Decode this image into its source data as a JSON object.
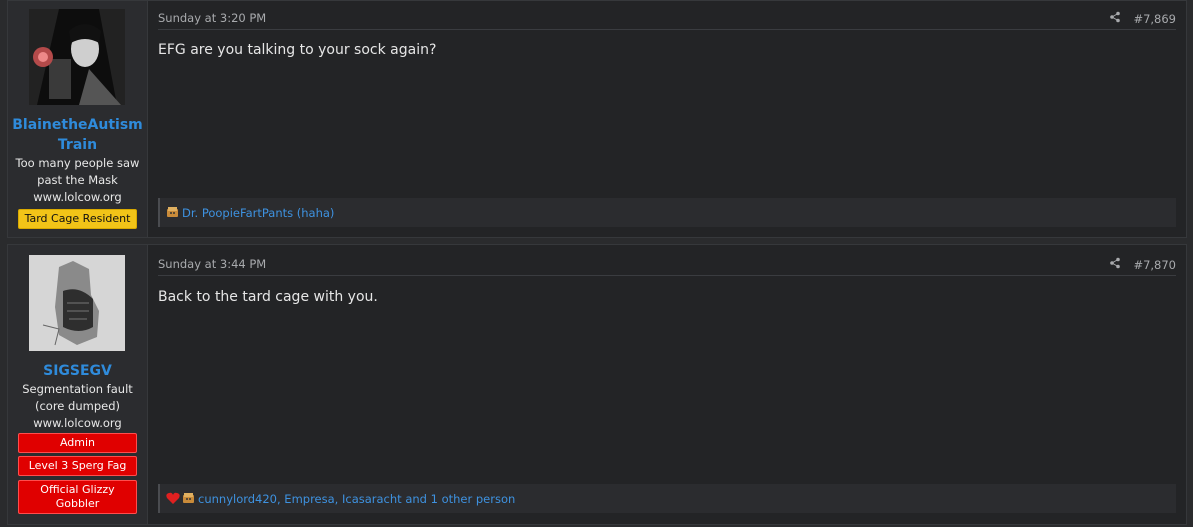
{
  "posts": [
    {
      "username": "BlainetheAutism Train",
      "user_title_lines": [
        "Too many people saw",
        "past the Mask",
        "www.lolcow.org"
      ],
      "banners": [
        "Tard Cage Resident"
      ],
      "date": "Sunday at 3:20 PM",
      "post_number": "#7,869",
      "message": "EFG are you talking to your sock again?",
      "reactions_text": "Dr. PoopieFartPants (haha)",
      "reaction_icons": [
        "haha-icon"
      ]
    },
    {
      "username": "SIGSEGV",
      "user_title_lines": [
        "Segmentation fault",
        "(core dumped)",
        "www.lolcow.org"
      ],
      "banners": [
        "Admin",
        "Level 3 Sperg Fag",
        "Official Glizzy Gobbler"
      ],
      "date": "Sunday at 3:44 PM",
      "post_number": "#7,870",
      "message": "Back to the tard cage with you.",
      "reactions_text": "cunnylord420, Empresa, Icasaracht and 1 other person",
      "reaction_icons": [
        "heart-icon",
        "haha-icon"
      ]
    }
  ],
  "colors": {
    "username": "#2f8bdb",
    "banner_yellow": "#f2c418",
    "banner_red": "#e00000",
    "link": "#3e92e0"
  }
}
